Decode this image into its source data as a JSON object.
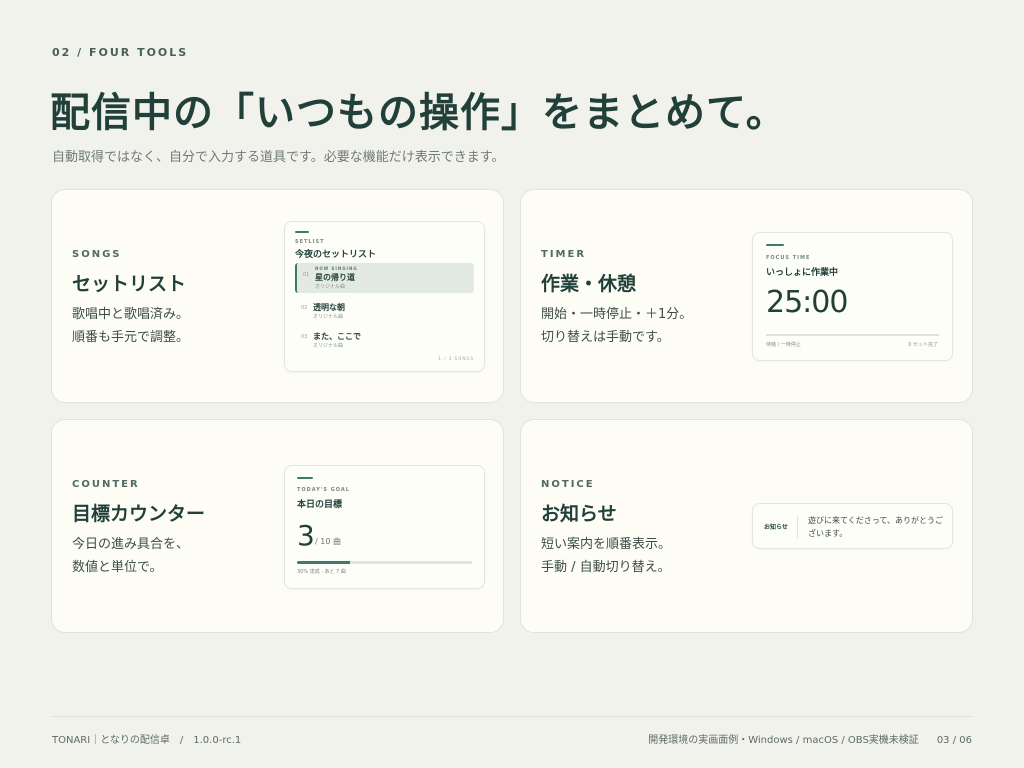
{
  "header": {
    "section_label": "02 / FOUR TOOLS",
    "headline": "配信中の「いつもの操作」をまとめて。",
    "subline": "自動取得ではなく、自分で入力する道具です。必要な機能だけ表示できます。"
  },
  "cards": {
    "songs": {
      "kicker": "SONGS",
      "title": "セットリスト",
      "desc_line1": "歌唱中と歌唱済み。",
      "desc_line2": "順番も手元で調整。",
      "mini": {
        "kicker": "SETLIST",
        "title": "今夜のセットリスト",
        "items": [
          {
            "num": "01",
            "now": "NOW SINGING",
            "name": "星の帰り道",
            "sub": "オリジナル曲"
          },
          {
            "num": "02",
            "name": "透明な朝",
            "sub": "オリジナル曲"
          },
          {
            "num": "03",
            "name": "また、ここで",
            "sub": "オリジナル曲"
          }
        ],
        "tally": "1 / 3 SONGS"
      }
    },
    "timer": {
      "kicker": "TIMER",
      "title": "作業・休憩",
      "desc_line1": "開始・一時停止・＋1分。",
      "desc_line2": "切り替えは手動です。",
      "mini": {
        "kicker": "FOCUS TIME",
        "title": "いっしょに作業中",
        "digits": "25:00",
        "foot_left": "待機 / 一時停止",
        "foot_right": "0 セット完了"
      }
    },
    "counter": {
      "kicker": "COUNTER",
      "title": "目標カウンター",
      "desc_line1": "今日の進み具合を、",
      "desc_line2": "数値と単位で。",
      "mini": {
        "kicker": "TODAY'S GOAL",
        "title": "本日の目標",
        "current": "3",
        "rest": "/ 10 曲",
        "progress": 0.3,
        "foot": "30% 達成 · あと 7 曲"
      }
    },
    "notice": {
      "kicker": "NOTICE",
      "title": "お知らせ",
      "desc_line1": "短い案内を順番表示。",
      "desc_line2": "手動 / 自動切り替え。",
      "mini": {
        "tag": "お知らせ",
        "message": "遊びに来てくださって、ありがとうございます。"
      }
    }
  },
  "footer": {
    "left": "TONARI｜となりの配信卓　/　1.0.0-rc.1",
    "right": "開発環境の実画面例・Windows / macOS / OBS実機未検証",
    "pager": "03 / 06"
  },
  "colors": {
    "background": "#f2f2ed",
    "card": "#fdfdf6",
    "accent": "#3f7a70",
    "heading": "#22403a"
  }
}
